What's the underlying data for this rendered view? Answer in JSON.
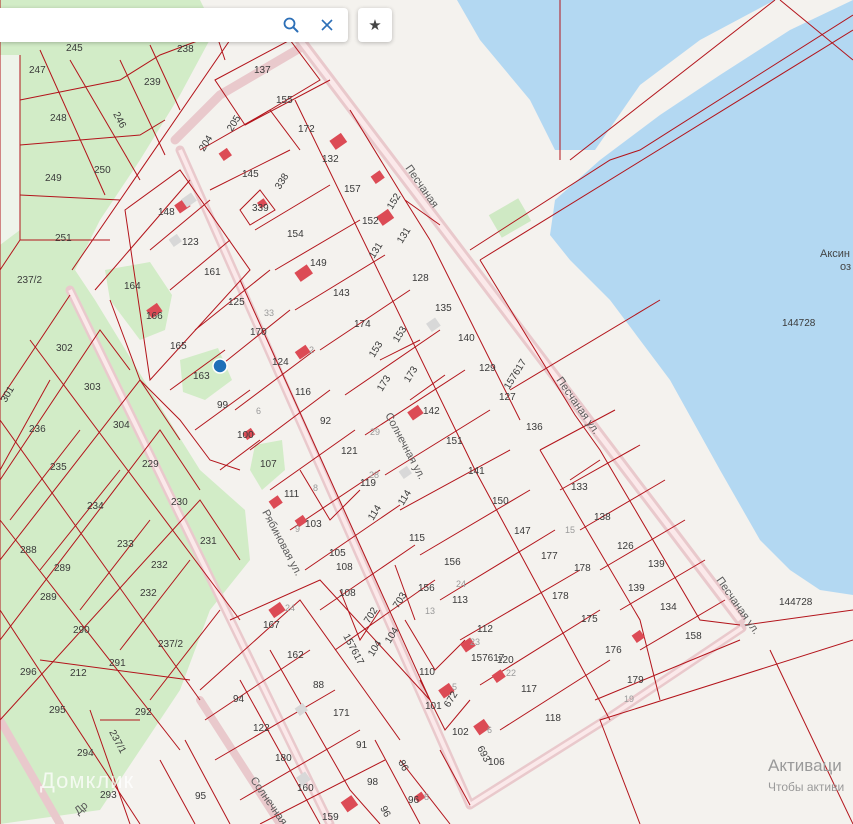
{
  "search": {
    "value": "",
    "placeholder": ""
  },
  "icons": {
    "search": "search-icon",
    "clear": "close-icon",
    "favorite": "star-icon",
    "location": "location-dot-icon"
  },
  "colors": {
    "water": "#b3d8f2",
    "forest": "#d2ecc7",
    "parcel_line": "#b3141b",
    "road": "#e9c9cc",
    "building": "#dc4b55",
    "marker": "#1f6fb8"
  },
  "roads": {
    "left_street": "Рябиновая ул.",
    "middle_street": "Солнечная ул.",
    "lower_street": "Солнечная",
    "right_street": "Песчаная ул.",
    "right_street_2": "Песчаная ул.",
    "top_street": "Песчаная",
    "bottom_road": "Др"
  },
  "lake": {
    "name": "Аксин",
    "name_2": "оз",
    "parcel_1": "144728",
    "parcel_2": "144728"
  },
  "watermark": "Домклик",
  "activation": {
    "title": "Активаци",
    "subtitle": "Чтобы активи"
  },
  "parcel_labels": [
    {
      "t": "245"
    },
    {
      "t": "238"
    },
    {
      "t": "247"
    },
    {
      "t": "239"
    },
    {
      "t": "248"
    },
    {
      "t": "246"
    },
    {
      "t": "249"
    },
    {
      "t": "250"
    },
    {
      "t": "251"
    },
    {
      "t": "237/2"
    },
    {
      "t": "302"
    },
    {
      "t": "303"
    },
    {
      "t": "301"
    },
    {
      "t": "236"
    },
    {
      "t": "304"
    },
    {
      "t": "235"
    },
    {
      "t": "229"
    },
    {
      "t": "234"
    },
    {
      "t": "230"
    },
    {
      "t": "233"
    },
    {
      "t": "231"
    },
    {
      "t": "232"
    },
    {
      "t": "232"
    },
    {
      "t": "288"
    },
    {
      "t": "289"
    },
    {
      "t": "289"
    },
    {
      "t": "290"
    },
    {
      "t": "296"
    },
    {
      "t": "212"
    },
    {
      "t": "291"
    },
    {
      "t": "237/2"
    },
    {
      "t": "295"
    },
    {
      "t": "292"
    },
    {
      "t": "237/1"
    },
    {
      "t": "294"
    },
    {
      "t": "293"
    },
    {
      "t": "137"
    },
    {
      "t": "155"
    },
    {
      "t": "205"
    },
    {
      "t": "204"
    },
    {
      "t": "172"
    },
    {
      "t": "132"
    },
    {
      "t": "145"
    },
    {
      "t": "157"
    },
    {
      "t": "338"
    },
    {
      "t": "339"
    },
    {
      "t": "148"
    },
    {
      "t": "152"
    },
    {
      "t": "152"
    },
    {
      "t": "123"
    },
    {
      "t": "154"
    },
    {
      "t": "131"
    },
    {
      "t": "131"
    },
    {
      "t": "161"
    },
    {
      "t": "149"
    },
    {
      "t": "128"
    },
    {
      "t": "164"
    },
    {
      "t": "143"
    },
    {
      "t": "166"
    },
    {
      "t": "125"
    },
    {
      "t": "135"
    },
    {
      "t": "174"
    },
    {
      "t": "170"
    },
    {
      "t": "165"
    },
    {
      "t": "153"
    },
    {
      "t": "153"
    },
    {
      "t": "140"
    },
    {
      "t": "124"
    },
    {
      "t": "163"
    },
    {
      "t": "129"
    },
    {
      "t": "173"
    },
    {
      "t": "173"
    },
    {
      "t": "157617"
    },
    {
      "t": "127"
    },
    {
      "t": "116"
    },
    {
      "t": "99"
    },
    {
      "t": "142"
    },
    {
      "t": "92"
    },
    {
      "t": "136"
    },
    {
      "t": "100"
    },
    {
      "t": "151"
    },
    {
      "t": "121"
    },
    {
      "t": "107"
    },
    {
      "t": "141"
    },
    {
      "t": "119"
    },
    {
      "t": "111"
    },
    {
      "t": "133"
    },
    {
      "t": "150"
    },
    {
      "t": "114"
    },
    {
      "t": "114"
    },
    {
      "t": "103"
    },
    {
      "t": "138"
    },
    {
      "t": "147"
    },
    {
      "t": "115"
    },
    {
      "t": "105"
    },
    {
      "t": "126"
    },
    {
      "t": "177"
    },
    {
      "t": "156"
    },
    {
      "t": "108"
    },
    {
      "t": "139"
    },
    {
      "t": "178"
    },
    {
      "t": "178"
    },
    {
      "t": "156"
    },
    {
      "t": "108"
    },
    {
      "t": "139"
    },
    {
      "t": "113"
    },
    {
      "t": "703"
    },
    {
      "t": "702"
    },
    {
      "t": "134"
    },
    {
      "t": "175"
    },
    {
      "t": "167"
    },
    {
      "t": "157617"
    },
    {
      "t": "112"
    },
    {
      "t": "104"
    },
    {
      "t": "104"
    },
    {
      "t": "158"
    },
    {
      "t": "162"
    },
    {
      "t": "157617"
    },
    {
      "t": "120"
    },
    {
      "t": "176"
    },
    {
      "t": "110"
    },
    {
      "t": "179"
    },
    {
      "t": "88"
    },
    {
      "t": "94"
    },
    {
      "t": "117"
    },
    {
      "t": "101"
    },
    {
      "t": "672"
    },
    {
      "t": "171"
    },
    {
      "t": "122"
    },
    {
      "t": "118"
    },
    {
      "t": "102"
    },
    {
      "t": "693"
    },
    {
      "t": "91"
    },
    {
      "t": "180"
    },
    {
      "t": "86"
    },
    {
      "t": "106"
    },
    {
      "t": "98"
    },
    {
      "t": "95"
    },
    {
      "t": "160"
    },
    {
      "t": "96"
    },
    {
      "t": "159"
    },
    {
      "t": "96"
    }
  ],
  "house_numbers": [
    {
      "t": "33"
    },
    {
      "t": "2"
    },
    {
      "t": "6"
    },
    {
      "t": "8"
    },
    {
      "t": "9"
    },
    {
      "t": "29"
    },
    {
      "t": "28"
    },
    {
      "t": "15"
    },
    {
      "t": "24"
    },
    {
      "t": "23"
    },
    {
      "t": "13"
    },
    {
      "t": "22"
    },
    {
      "t": "5"
    },
    {
      "t": "6"
    },
    {
      "t": "19"
    },
    {
      "t": "8"
    },
    {
      "t": "24"
    }
  ]
}
